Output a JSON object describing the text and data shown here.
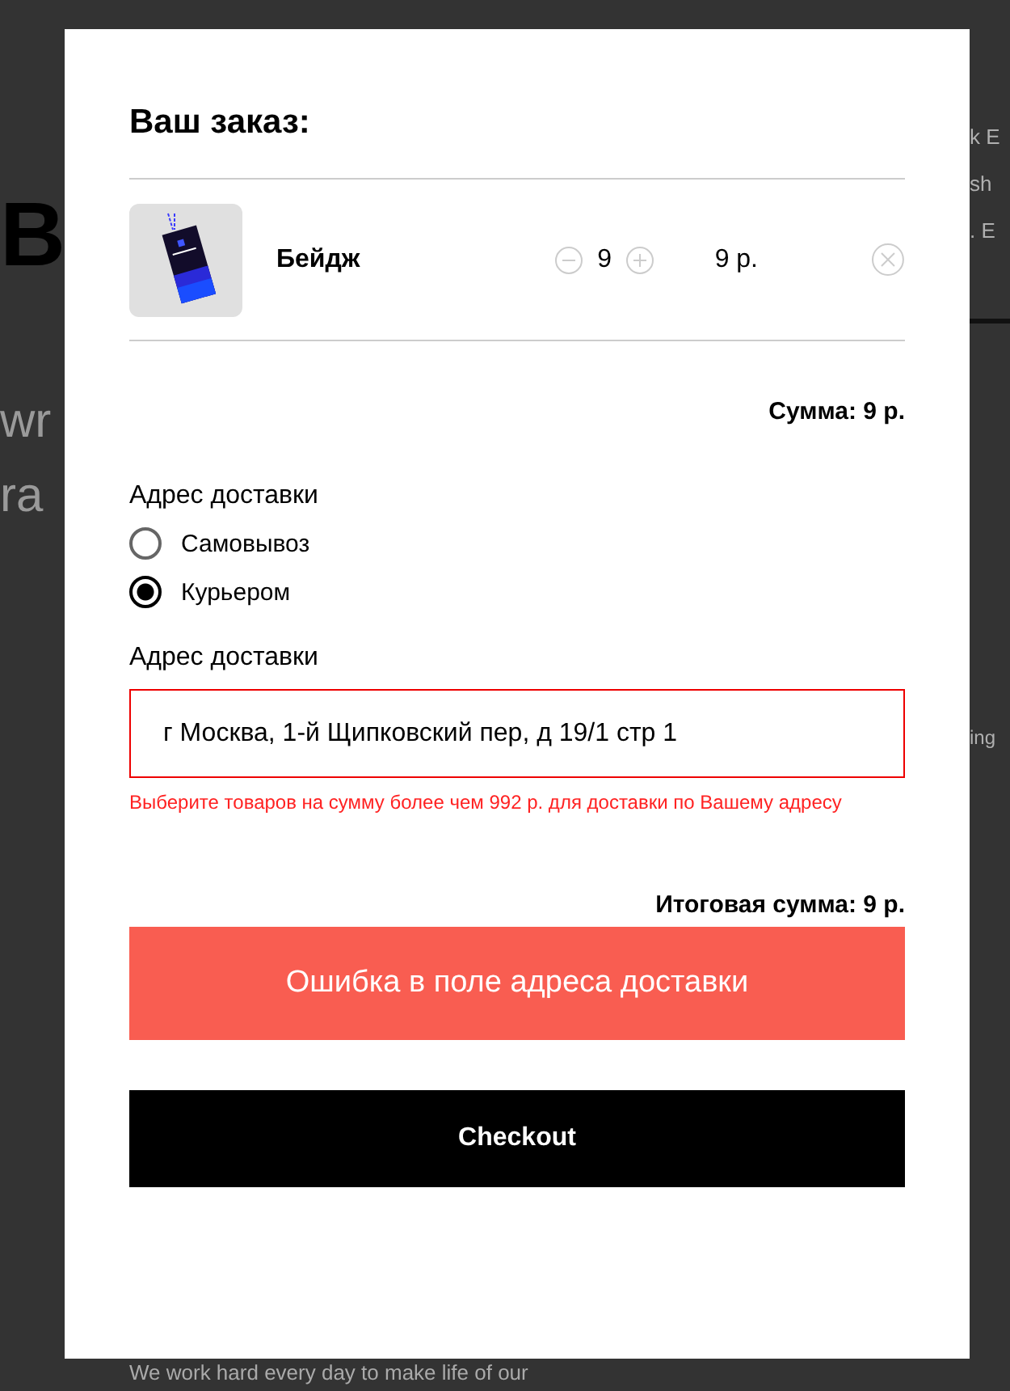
{
  "background": {
    "left_fragments": [
      "B",
      "wr",
      "ra"
    ],
    "right_fragments": [
      "k E",
      "sh",
      ". E",
      "ing"
    ],
    "footer_text": "We work hard every day to make life of our"
  },
  "order": {
    "title": "Ваш заказ:",
    "items": [
      {
        "name": "Бейдж",
        "quantity": "9",
        "price": "9 р."
      }
    ],
    "subtotal": "Сумма: 9 р.",
    "delivery_label": "Адрес доставки",
    "delivery_options": [
      {
        "label": "Самовывоз",
        "selected": false
      },
      {
        "label": "Курьером",
        "selected": true
      }
    ],
    "address_label": "Адрес доставки",
    "address_value": "г Москва, 1-й Щипковский пер, д 19/1 стр 1",
    "address_invalid": true,
    "error_message": "Выберите товаров на сумму более чем 992 р. для доставки по Вашему адресу",
    "total": "Итоговая сумма: 9 р.",
    "submit_button": "Ошибка в поле адреса доставки",
    "checkout_button": "Checkout"
  }
}
